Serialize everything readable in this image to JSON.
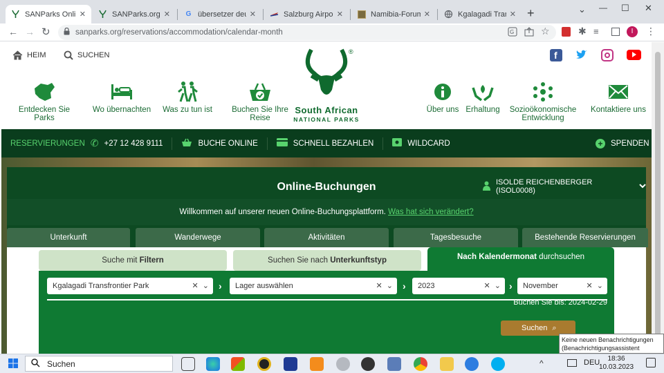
{
  "browser": {
    "tabs": [
      {
        "title": "SANParks Online-B",
        "active": true
      },
      {
        "title": "SANParks.org Foru"
      },
      {
        "title": "übersetzer deutsch"
      },
      {
        "title": "Salzburg Airport"
      },
      {
        "title": "Namibia-Forum: w"
      },
      {
        "title": "Kgalagadi Transfro"
      }
    ],
    "new_tab": "+",
    "window_controls": [
      "⌄",
      "—",
      "☐",
      "✕"
    ],
    "url": "sanparks.org/reservations/accommodation/calendar-month"
  },
  "site": {
    "top_nav": {
      "home": "HEIM",
      "search": "SUCHEN"
    },
    "social": [
      {
        "name": "facebook-icon",
        "color": "#3b5998"
      },
      {
        "name": "twitter-icon",
        "color": "#1da1f2"
      },
      {
        "name": "instagram-icon",
        "color": "#c13584"
      },
      {
        "name": "youtube-icon",
        "color": "#ff0000"
      }
    ],
    "categories_left": [
      {
        "label": "Entdecken Sie Parks",
        "icon": "africa-map-icon"
      },
      {
        "label": "Wo übernachten",
        "icon": "bed-icon"
      },
      {
        "label": "Was zu tun ist",
        "icon": "hikers-icon"
      },
      {
        "label": "Buchen Sie Ihre Reise",
        "icon": "basket-icon"
      }
    ],
    "categories_right": [
      {
        "label": "Über uns",
        "icon": "info-icon"
      },
      {
        "label": "Erhaltung",
        "icon": "hands-leaf-icon"
      },
      {
        "label": "Sozioökonomische Entwicklung",
        "icon": "community-icon"
      },
      {
        "label": "Kontaktiere uns",
        "icon": "mail-icon"
      }
    ],
    "logo": {
      "line1": "South African",
      "line2": "NATIONAL PARKS",
      "registered": "®"
    },
    "bar": {
      "reservations": "RESERVIERUNGEN",
      "phone": "+27 12 428 9111",
      "book_online": "BUCHE ONLINE",
      "quick_pay": "SCHNELL BEZAHLEN",
      "wildcard": "WILDCARD",
      "donate": "SPENDEN"
    },
    "booking": {
      "title": "Online-Buchungen",
      "user": "ISOLDE REICHENBERGER (ISOL0008)",
      "welcome": "Willkommen auf unserer neuen Online-Buchungsplattform.",
      "welcome_link": "Was hat sich verändert?",
      "main_tabs": [
        "Unterkunft",
        "Wanderwege",
        "Aktivitäten",
        "Tagesbesuche",
        "Bestehende Reservierungen"
      ],
      "search_tabs": [
        {
          "pre": "Suche mit ",
          "bold": "Filtern",
          "post": ""
        },
        {
          "pre": "Suchen Sie nach ",
          "bold": "Unterkunftstyp",
          "post": ""
        },
        {
          "pre": "",
          "bold": "Nach Kalendermonat",
          "post": " durchsuchen"
        }
      ],
      "park": "Kgalagadi Transfrontier Park",
      "camp": "Lager auswählen",
      "year": "2023",
      "month": "November",
      "book_until": "Buchen Sie bis: 2024-02-29",
      "search_button": "Suchen"
    }
  },
  "taskbar": {
    "search": "Suchen",
    "lang": "DEU",
    "time": "18:36",
    "date": "10.03.2023"
  },
  "tooltip": {
    "line1": "Keine neuen Benachrichtigungen",
    "line2": "(Benachrichtigungsassistent aktiviert)"
  }
}
